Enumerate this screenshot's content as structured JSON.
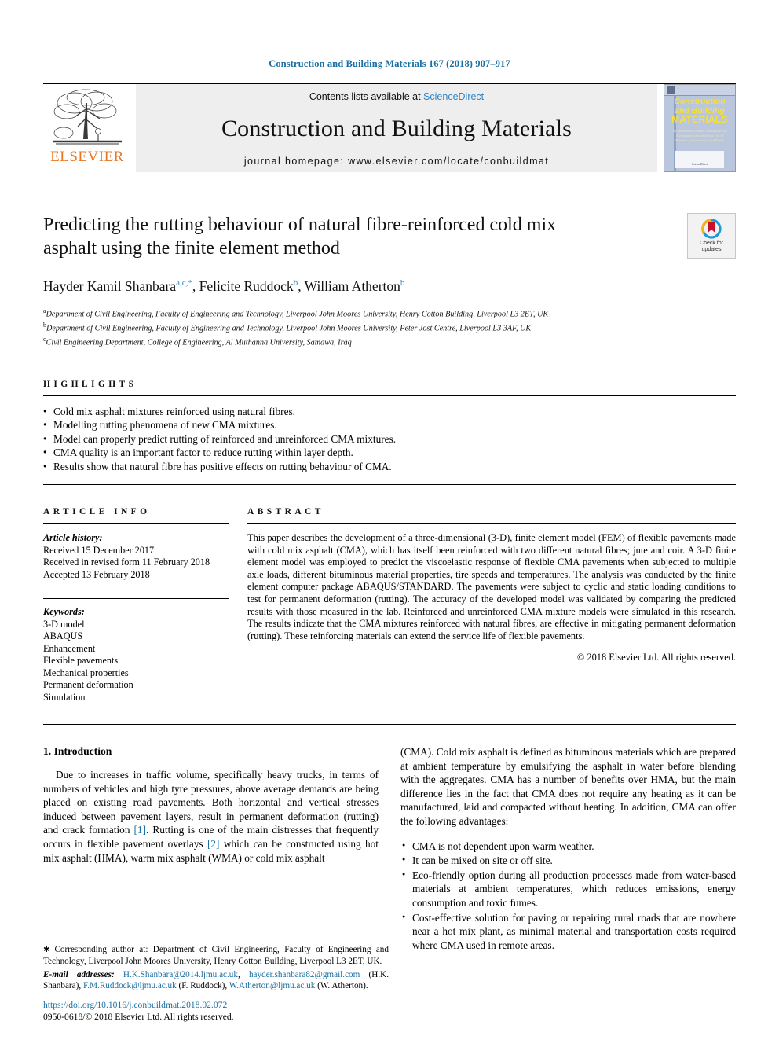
{
  "running_head": "Construction and Building Materials 167 (2018) 907–917",
  "header": {
    "contents_prefix": "Contents lists available at ",
    "sciencedirect": "ScienceDirect",
    "journal_title": "Construction and Building Materials",
    "homepage": "journal homepage: www.elsevier.com/locate/conbuildmat",
    "publisher": "ELSEVIER",
    "cover": {
      "line1": "Construction",
      "line2": "and Building",
      "line3": "MATERIALS",
      "blurb": "An International Journal Dedicated to the Investigation and Innovative Use of Materials in Construction and Repair",
      "footer": "ScienceDirect"
    }
  },
  "article": {
    "title": "Predicting the rutting behaviour of natural fibre-reinforced cold mix asphalt using the finite element method",
    "crossmark_label_line1": "Check for",
    "crossmark_label_line2": "updates",
    "authors": [
      {
        "name": "Hayder Kamil Shanbara",
        "sup": "a,c,*",
        "sep": ", "
      },
      {
        "name": "Felicite Ruddock",
        "sup": "b",
        "sep": ", "
      },
      {
        "name": "William Atherton",
        "sup": "b",
        "sep": ""
      }
    ],
    "affiliations": [
      {
        "mark": "a",
        "text": "Department of Civil Engineering, Faculty of Engineering and Technology, Liverpool John Moores University, Henry Cotton Building, Liverpool L3 2ET, UK"
      },
      {
        "mark": "b",
        "text": "Department of Civil Engineering, Faculty of Engineering and Technology, Liverpool John Moores University, Peter Jost Centre, Liverpool L3 3AF, UK"
      },
      {
        "mark": "c",
        "text": "Civil Engineering Department, College of Engineering, Al Muthanna University, Samawa, Iraq"
      }
    ]
  },
  "highlights": {
    "label": "HIGHLIGHTS",
    "items": [
      "Cold mix asphalt mixtures reinforced using natural fibres.",
      "Modelling rutting phenomena of new CMA mixtures.",
      "Model can properly predict rutting of reinforced and unreinforced CMA mixtures.",
      "CMA quality is an important factor to reduce rutting within layer depth.",
      "Results show that natural fibre has positive effects on rutting behaviour of CMA."
    ]
  },
  "article_info": {
    "label": "ARTICLE INFO",
    "history_label": "Article history:",
    "history": [
      "Received 15 December 2017",
      "Received in revised form 11 February 2018",
      "Accepted 13 February 2018"
    ],
    "keywords_label": "Keywords:",
    "keywords": [
      "3-D model",
      "ABAQUS",
      "Enhancement",
      "Flexible pavements",
      "Mechanical properties",
      "Permanent deformation",
      "Simulation"
    ]
  },
  "abstract": {
    "label": "ABSTRACT",
    "text": "This paper describes the development of a three-dimensional (3-D), finite element model (FEM) of flexible pavements made with cold mix asphalt (CMA), which has itself been reinforced with two different natural fibres; jute and coir. A 3-D finite element model was employed to predict the viscoelastic response of flexible CMA pavements when subjected to multiple axle loads, different bituminous material properties, tire speeds and temperatures. The analysis was conducted by the finite element computer package ABAQUS/STANDARD. The pavements were subject to cyclic and static loading conditions to test for permanent deformation (rutting). The accuracy of the developed model was validated by comparing the predicted results with those measured in the lab. Reinforced and unreinforced CMA mixture models were simulated in this research. The results indicate that the CMA mixtures reinforced with natural fibres, are effective in mitigating permanent deformation (rutting). These reinforcing materials can extend the service life of flexible pavements.",
    "copyright": "© 2018 Elsevier Ltd. All rights reserved."
  },
  "body": {
    "section_title": "1. Introduction",
    "left_paragraph_a": "Due to increases in traffic volume, specifically heavy trucks, in terms of numbers of vehicles and high tyre pressures, above average demands are being placed on existing road pavements. Both horizontal and vertical stresses induced between pavement layers, result in permanent deformation (rutting) and crack formation ",
    "ref1": "[1]",
    "left_paragraph_b": ". Rutting is one of the main distresses that frequently occurs in flexible pavement overlays ",
    "ref2": "[2]",
    "left_paragraph_c": " which can be constructed using hot mix asphalt (HMA), warm mix asphalt (WMA) or cold mix asphalt",
    "right_paragraph": "(CMA). Cold mix asphalt is defined as bituminous materials which are prepared at ambient temperature by emulsifying the asphalt in water before blending with the aggregates. CMA has a number of benefits over HMA, but the main difference lies in the fact that CMA does not require any heating as it can be manufactured, laid and compacted without heating. In addition, CMA can offer the following advantages:",
    "advantages": [
      "CMA is not dependent upon warm weather.",
      "It can be mixed on site or off site.",
      "Eco-friendly option during all production processes made from water-based materials at ambient temperatures, which reduces emissions, energy consumption and toxic fumes.",
      "Cost-effective solution for paving or repairing rural roads that are nowhere near a hot mix plant, as minimal material and transportation costs required where CMA used in remote areas."
    ]
  },
  "footnote": {
    "corresponding": "Corresponding author at: Department of Civil Engineering, Faculty of Engineering and Technology, Liverpool John Moores University, Henry Cotton Building, Liverpool L3 2ET, UK.",
    "email_label": "E-mail addresses:",
    "emails": [
      {
        "addr": "H.K.Shanbara@2014.ljmu.ac.uk",
        "after": ", "
      },
      {
        "addr": "hayder.shanbara82@gmail.com",
        "after": " (H.K. Shanbara), "
      },
      {
        "addr": "F.M.Ruddock@ljmu.ac.uk",
        "after": " (F. Ruddock), "
      },
      {
        "addr": "W.Atherton@ljmu.ac.uk",
        "after": " (W. Atherton)."
      }
    ],
    "doi": "https://doi.org/10.1016/j.conbuildmat.2018.02.072",
    "issn": "0950-0618/© 2018 Elsevier Ltd. All rights reserved."
  },
  "colors": {
    "link": "#1a6fa3",
    "elsevier_orange": "#e87722",
    "sciencedirect_blue": "#2f84c6",
    "cover_blue": "#b9c6dd",
    "cover_yellow": "#f5e03c"
  }
}
